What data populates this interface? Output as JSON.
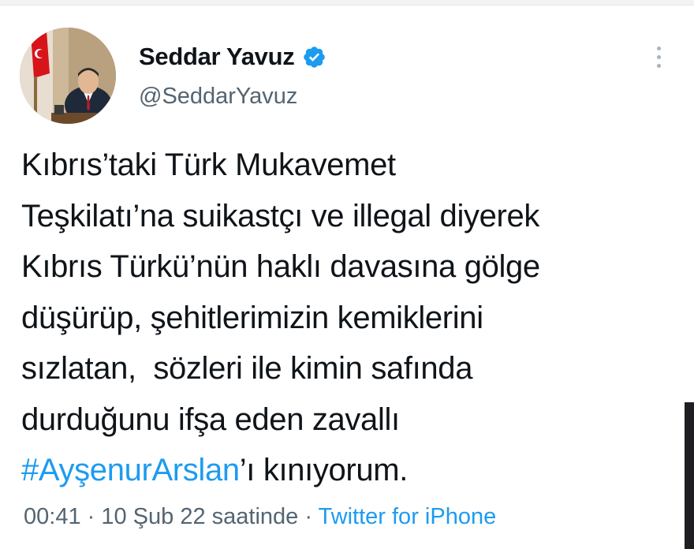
{
  "tweet": {
    "author": {
      "display_name": "Seddar Yavuz",
      "handle": "@SeddarYavuz",
      "verified": true,
      "verified_icon": "verified-badge-icon",
      "avatar": "profile-photo"
    },
    "text_lines": [
      "Kıbrıs’taki Türk Mukavemet",
      "Teşkilatı’na suikastçı ve illegal diyerek",
      "Kıbrıs Türkü’nün haklı davasına gölge",
      "düşürüp, şehitlerimizin kemiklerini",
      "sızlatan,  sözleri ile kimin safında",
      "durduğunu ifşa eden zavallı"
    ],
    "hashtag": "#AyşenurArslan",
    "text_tail": "’ı kınıyorum.",
    "time": "00:41",
    "separator": " · ",
    "date": "10 Şub 22 saatinde",
    "source": "Twitter for iPhone",
    "more_icon": "more-vertical-icon"
  },
  "colors": {
    "text": "#0f1419",
    "secondary": "#536471",
    "link": "#1d9bf0",
    "verified": "#1d9bf0"
  }
}
